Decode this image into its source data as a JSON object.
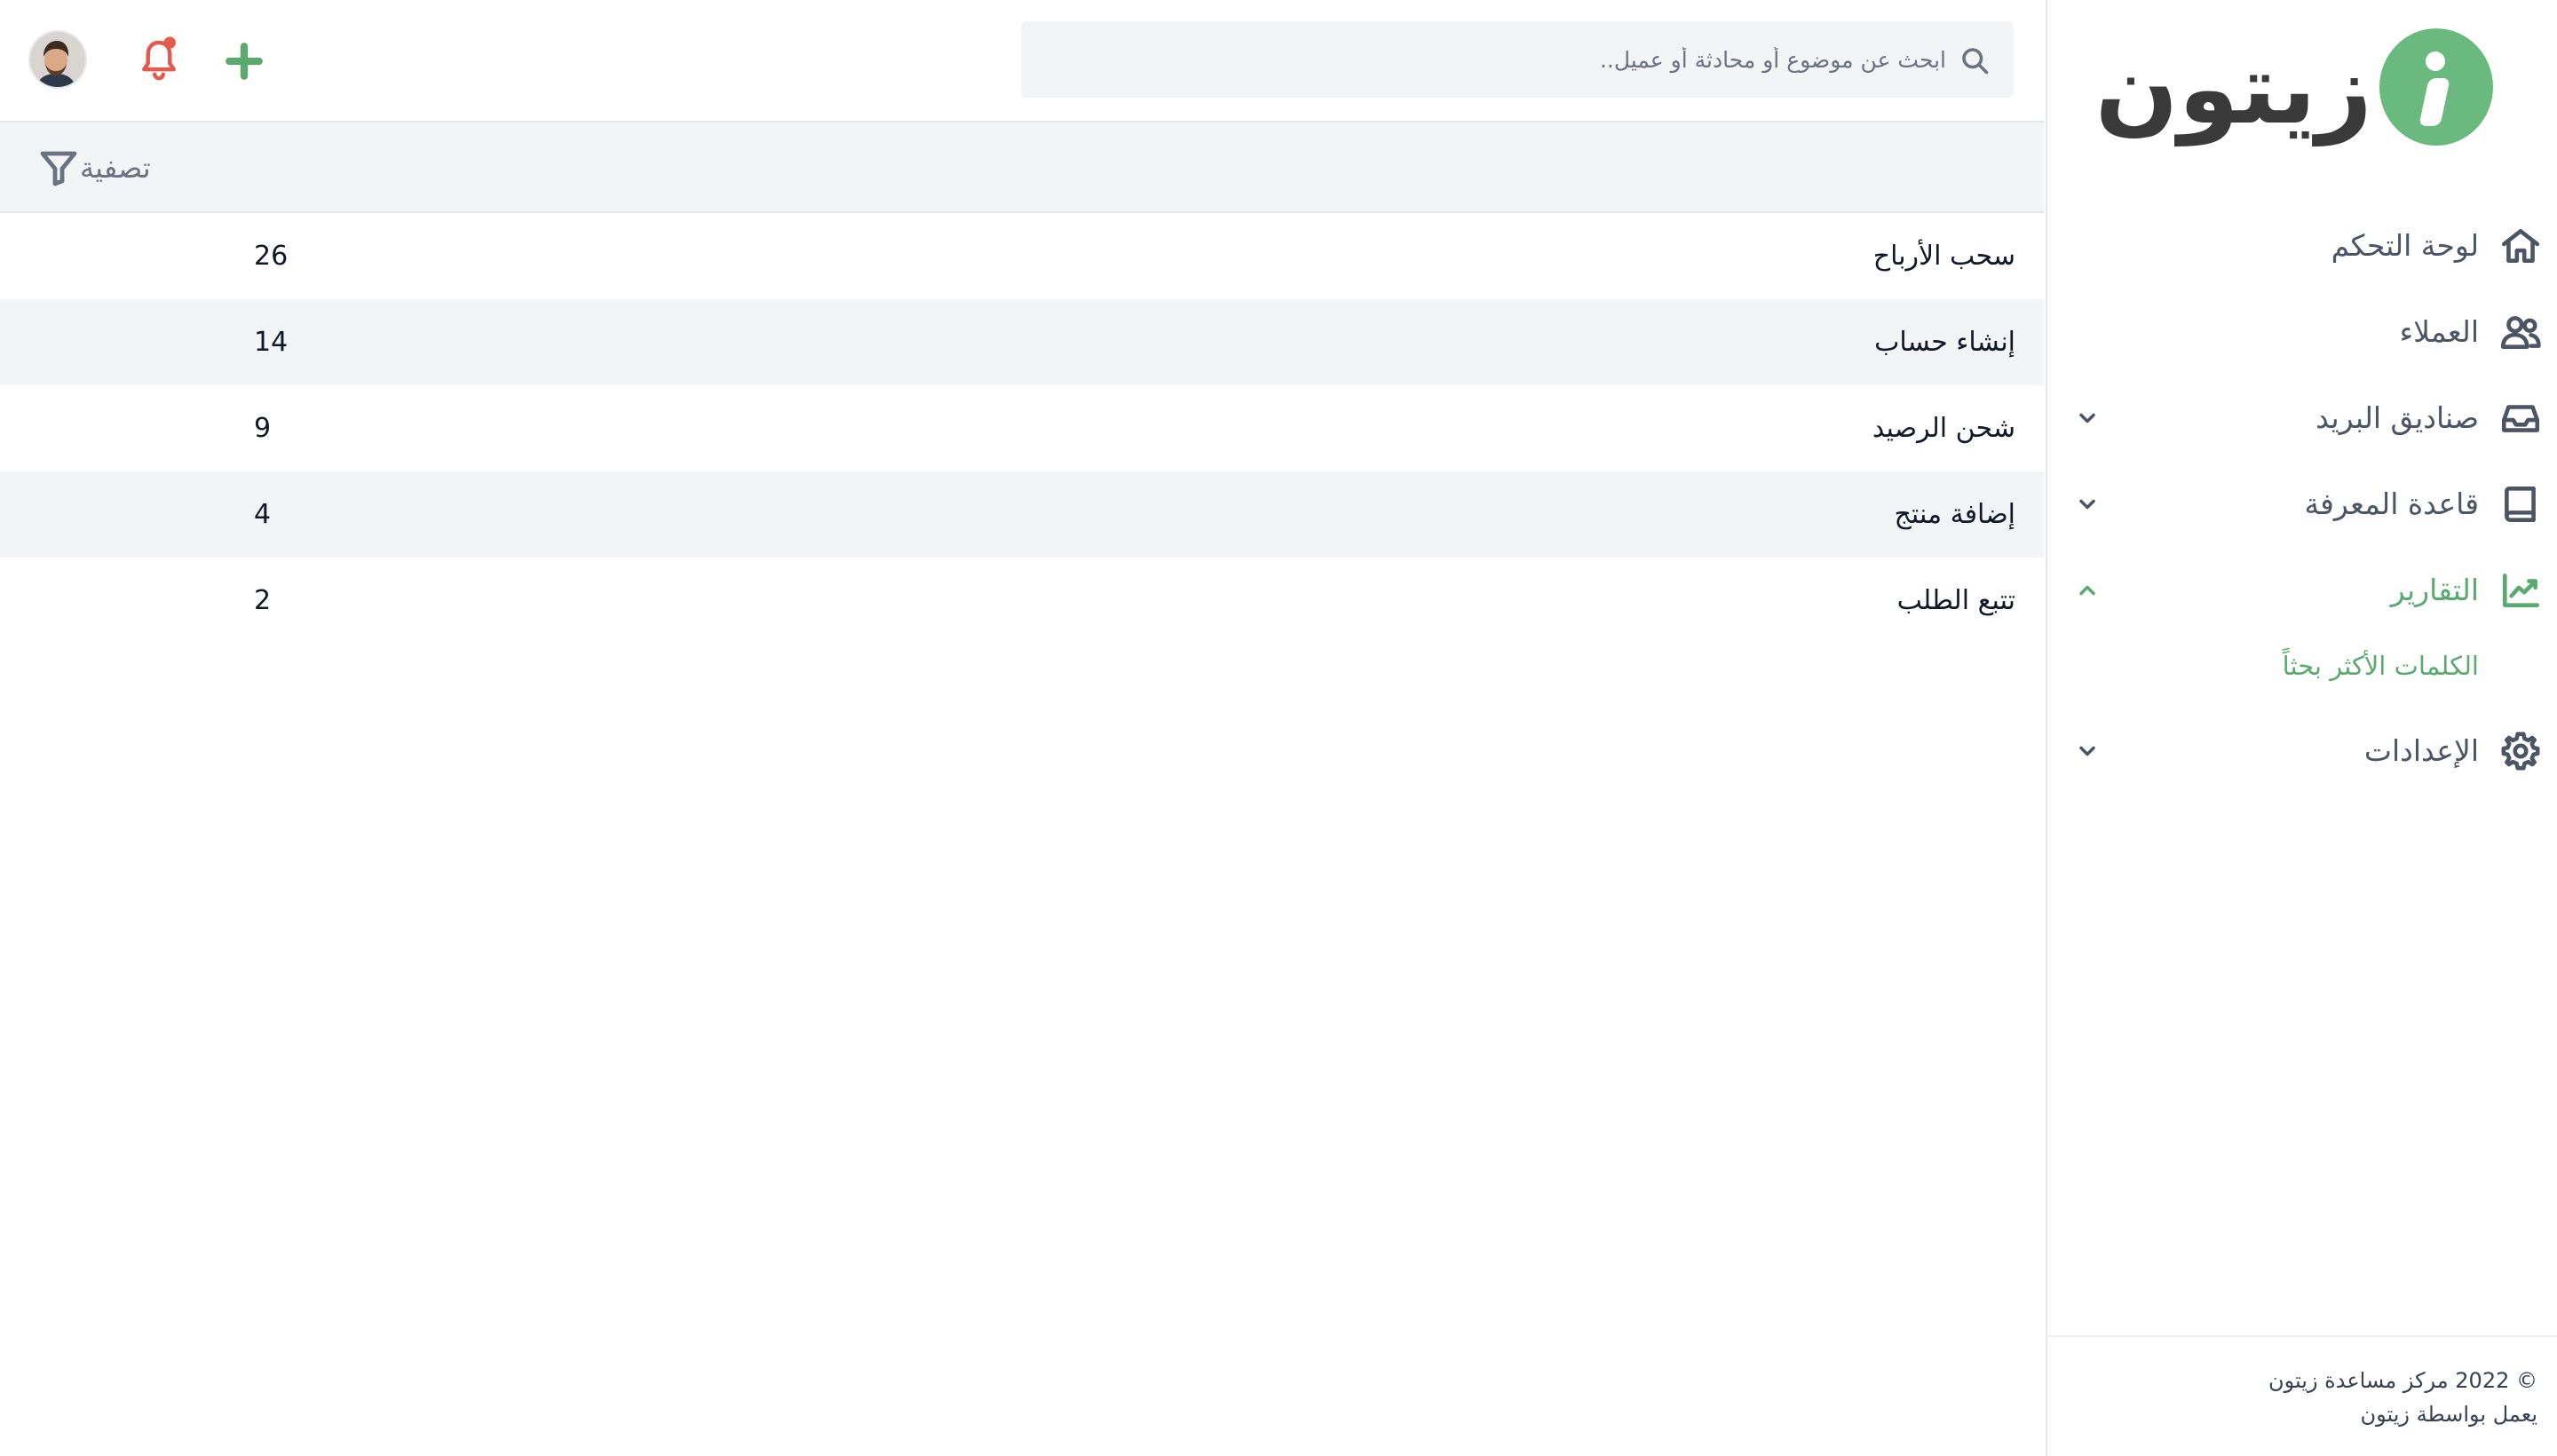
{
  "brand": {
    "name": "زيتون",
    "color": "#6ab97f"
  },
  "header": {
    "search": {
      "placeholder": "ابحث عن موضوع أو محادثة أو عميل..",
      "icon": "search-icon"
    },
    "add_icon": "plus-icon",
    "notifications_icon": "bell-icon",
    "notification_color": "#e25c4d",
    "avatar_alt": "user-avatar"
  },
  "sidebar": {
    "items": [
      {
        "label": "لوحة التحكم",
        "icon": "home-icon",
        "expandable": false
      },
      {
        "label": "العملاء",
        "icon": "users-icon",
        "expandable": false
      },
      {
        "label": "صناديق البريد",
        "icon": "inbox-icon",
        "expandable": true,
        "expanded": false
      },
      {
        "label": "قاعدة المعرفة",
        "icon": "book-icon",
        "expandable": true,
        "expanded": false
      },
      {
        "label": "التقارير",
        "icon": "chart-icon",
        "expandable": true,
        "expanded": true,
        "active": true,
        "children": [
          {
            "label": "الكلمات الأكثر بحثاً"
          }
        ]
      },
      {
        "label": "الإعدادات",
        "icon": "gear-icon",
        "expandable": true,
        "expanded": false
      }
    ],
    "footer": {
      "copyright": "© 2022 مركز مساعدة زيتون",
      "powered_by": "يعمل بواسطة زيتون"
    }
  },
  "filter": {
    "label": "تصفية",
    "icon": "filter-icon"
  },
  "table": {
    "rows": [
      {
        "term": "سحب الأرباح",
        "count": "26"
      },
      {
        "term": "إنشاء حساب",
        "count": "14"
      },
      {
        "term": "شحن الرصيد",
        "count": "9"
      },
      {
        "term": "إضافة منتج",
        "count": "4"
      },
      {
        "term": "تتبع الطلب",
        "count": "2"
      }
    ]
  },
  "colors": {
    "accent": "#5aaa6f",
    "stripe": "#f3f4f6",
    "border": "#e5e7eb"
  }
}
